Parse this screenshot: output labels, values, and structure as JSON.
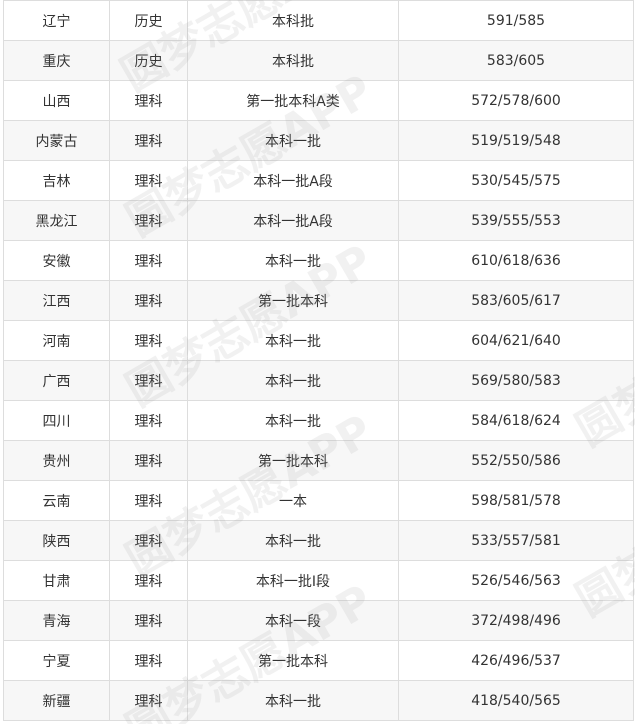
{
  "rows": [
    {
      "province": "辽宁",
      "subject": "历史",
      "batch": "本科批",
      "scores": "591/585"
    },
    {
      "province": "重庆",
      "subject": "历史",
      "batch": "本科批",
      "scores": "583/605"
    },
    {
      "province": "山西",
      "subject": "理科",
      "batch": "第一批本科A类",
      "scores": "572/578/600"
    },
    {
      "province": "内蒙古",
      "subject": "理科",
      "batch": "本科一批",
      "scores": "519/519/548"
    },
    {
      "province": "吉林",
      "subject": "理科",
      "batch": "本科一批A段",
      "scores": "530/545/575"
    },
    {
      "province": "黑龙江",
      "subject": "理科",
      "batch": "本科一批A段",
      "scores": "539/555/553"
    },
    {
      "province": "安徽",
      "subject": "理科",
      "batch": "本科一批",
      "scores": "610/618/636"
    },
    {
      "province": "江西",
      "subject": "理科",
      "batch": "第一批本科",
      "scores": "583/605/617"
    },
    {
      "province": "河南",
      "subject": "理科",
      "batch": "本科一批",
      "scores": "604/621/640"
    },
    {
      "province": "广西",
      "subject": "理科",
      "batch": "本科一批",
      "scores": "569/580/583"
    },
    {
      "province": "四川",
      "subject": "理科",
      "batch": "本科一批",
      "scores": "584/618/624"
    },
    {
      "province": "贵州",
      "subject": "理科",
      "batch": "第一批本科",
      "scores": "552/550/586"
    },
    {
      "province": "云南",
      "subject": "理科",
      "batch": "一本",
      "scores": "598/581/578"
    },
    {
      "province": "陕西",
      "subject": "理科",
      "batch": "本科一批",
      "scores": "533/557/581"
    },
    {
      "province": "甘肃",
      "subject": "理科",
      "batch": "本科一批Ⅰ段",
      "scores": "526/546/563"
    },
    {
      "province": "青海",
      "subject": "理科",
      "batch": "本科一段",
      "scores": "372/498/496"
    },
    {
      "province": "宁夏",
      "subject": "理科",
      "batch": "第一批本科",
      "scores": "426/496/537"
    },
    {
      "province": "新疆",
      "subject": "理科",
      "batch": "本科一批",
      "scores": "418/540/565"
    }
  ],
  "watermark": "圆梦志愿APP"
}
